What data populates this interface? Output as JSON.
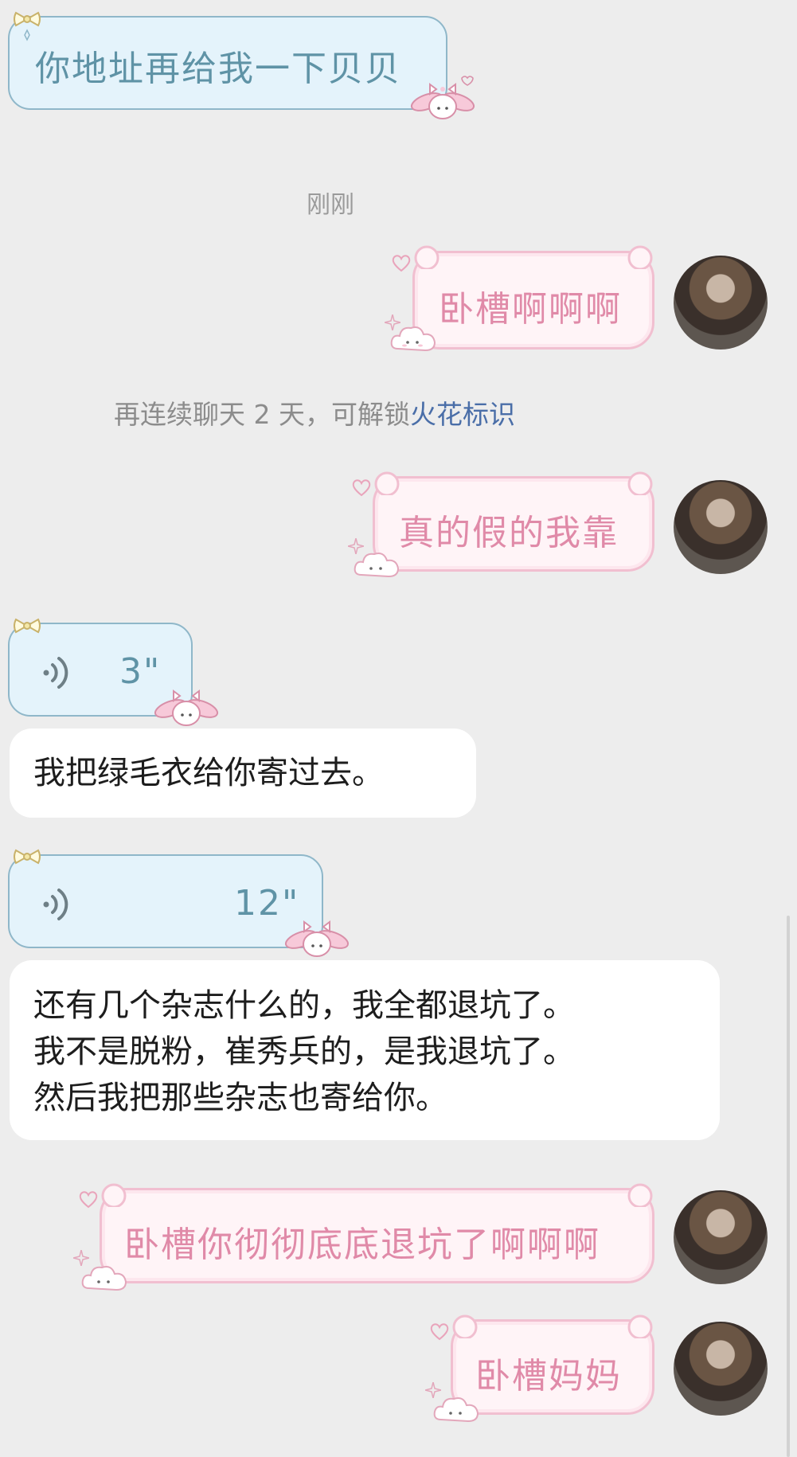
{
  "messages": [
    {
      "id": "m1",
      "type": "text-in",
      "text": "你地址再给我一下贝贝"
    },
    {
      "id": "t1",
      "type": "time",
      "text": "刚刚"
    },
    {
      "id": "m2",
      "type": "text-out",
      "text": "卧槽啊啊啊"
    },
    {
      "id": "s1",
      "type": "system",
      "text": "再连续聊天 2 天，可解锁",
      "link": "火花标识"
    },
    {
      "id": "m3",
      "type": "text-out",
      "text": "真的假的我靠"
    },
    {
      "id": "m4",
      "type": "voice-in",
      "duration": "3\""
    },
    {
      "id": "m5",
      "type": "transcript",
      "text": "我把绿毛衣给你寄过去。"
    },
    {
      "id": "m6",
      "type": "voice-in",
      "duration": "12\""
    },
    {
      "id": "m7",
      "type": "transcript",
      "lines": [
        "还有几个杂志什么的，我全都退坑了。",
        "我不是脱粉，崔秀兵的，是我退坑了。",
        "然后我把那些杂志也寄给你。"
      ]
    },
    {
      "id": "m8",
      "type": "text-out",
      "text": "卧槽你彻彻底底退坑了啊啊啊"
    },
    {
      "id": "m9",
      "type": "text-out",
      "text": "卧槽妈妈"
    }
  ],
  "colors": {
    "background": "#ededed",
    "incoming_bubble": "#e4f3fb",
    "incoming_text": "#5f93a6",
    "outgoing_bubble": "#fff4f7",
    "outgoing_border": "#f1bfd0",
    "outgoing_text": "#e08aa8",
    "link": "#4a6ea8"
  },
  "icons": {
    "voice": "voice-wave-icon",
    "bow": "bow-sticker-icon",
    "bunny": "bunny-sticker-icon",
    "cloud": "cloud-sticker-icon",
    "heart": "heart-sticker-icon",
    "sparkle": "sparkle-icon"
  }
}
